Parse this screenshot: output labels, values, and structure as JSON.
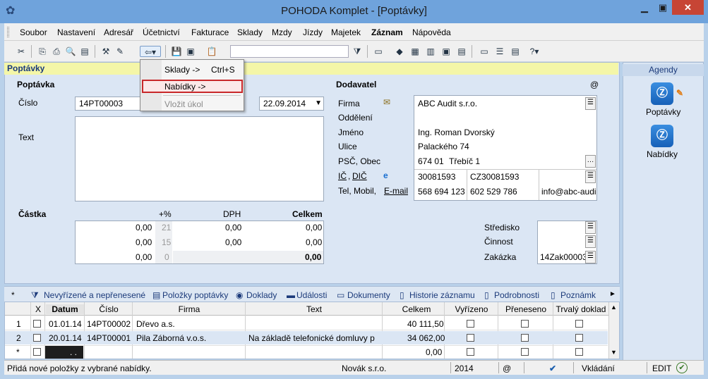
{
  "window": {
    "title": "POHODA Komplet - [Poptávky]",
    "minimize": "▁",
    "maximize": "▣",
    "close": "✕"
  },
  "menu": [
    "Soubor",
    "Nastavení",
    "Adresář",
    "Účetnictví",
    "Fakturace",
    "Sklady",
    "Mzdy",
    "Jízdy",
    "Majetek",
    "Záznam",
    "Nápověda"
  ],
  "section_title": "Poptávky",
  "popup": {
    "items": [
      {
        "label": "Sklady ->",
        "shortcut": "Ctrl+S"
      },
      {
        "label": "Nabídky ->",
        "shortcut": ""
      },
      {
        "label": "Vložit úkol",
        "shortcut": ""
      }
    ]
  },
  "poptavka": {
    "heading": "Poptávka",
    "cislo_label": "Číslo",
    "cislo_value": "14PT00003",
    "date_value": "22.09.2014",
    "text_label": "Text"
  },
  "castka": {
    "heading": "Částka",
    "col_pct": "+%",
    "col_dph": "DPH",
    "col_celkem": "Celkem",
    "rows": [
      {
        "zaklad": "0,00",
        "pct": "21",
        "dph": "0,00",
        "celkem": "0,00"
      },
      {
        "zaklad": "0,00",
        "pct": "15",
        "dph": "0,00",
        "celkem": "0,00"
      },
      {
        "zaklad": "0,00",
        "pct": "0",
        "dph": "",
        "celkem": "0,00"
      }
    ]
  },
  "dodavatel": {
    "heading": "Dodavatel",
    "at": "@",
    "firma_label": "Firma",
    "firma": "ABC Audit s.r.o.",
    "oddeleni_label": "Oddělení",
    "jmeno_label": "Jméno",
    "jmeno": "Ing. Roman Dvorský",
    "ulice_label": "Ulice",
    "ulice": "Palackého 74",
    "psc_label": "PSČ, Obec",
    "psc": "674 01",
    "obec": "Třebíč 1",
    "ic_label": "IČ",
    "dic_label": "DIČ",
    "ic": "30081593",
    "dic": "CZ30081593",
    "tel_label": "Tel, Mobil,",
    "email_label": "E-mail",
    "tel": "568 694 123",
    "mobil": "602 529 786",
    "email": "info@abc-audi"
  },
  "assign": {
    "stredisko_label": "Středisko",
    "cinnost_label": "Činnost",
    "zakazka_label": "Zakázka",
    "zakazka": "14Zak00003"
  },
  "agendy": {
    "title": "Agendy",
    "items": [
      "Poptávky",
      "Nabídky"
    ]
  },
  "tabs": [
    "*",
    "Nevyřízené a nepřenesené",
    "Položky poptávky",
    "Doklady",
    "Události",
    "Dokumenty",
    "Historie záznamu",
    "Podrobnosti",
    "Poznámk"
  ],
  "grid": {
    "columns": [
      "X",
      "Datum",
      "Číslo",
      "Firma",
      "Text",
      "Celkem",
      "Vyřízeno",
      "Přeneseno",
      "Trvalý doklad"
    ],
    "rows": [
      {
        "n": "1",
        "datum": "01.01.14",
        "cislo": "14PT00002",
        "firma": "Dřevo a.s.",
        "text": "",
        "celkem": "40 111,50"
      },
      {
        "n": "2",
        "datum": "20.01.14",
        "cislo": "14PT00001",
        "firma": "Pila Záborná v.o.s.",
        "text": "Na základě telefonické domluvy p",
        "celkem": "34 062,00"
      },
      {
        "n": "*",
        "datum": ". .",
        "cislo": "",
        "firma": "",
        "text": "",
        "celkem": "0,00"
      }
    ]
  },
  "status": {
    "message": "Přidá nové položky z vybrané nabídky.",
    "company": "Novák s.r.o.",
    "year": "2014",
    "at": "@",
    "mode": "Vkládání",
    "edit": "EDIT"
  }
}
